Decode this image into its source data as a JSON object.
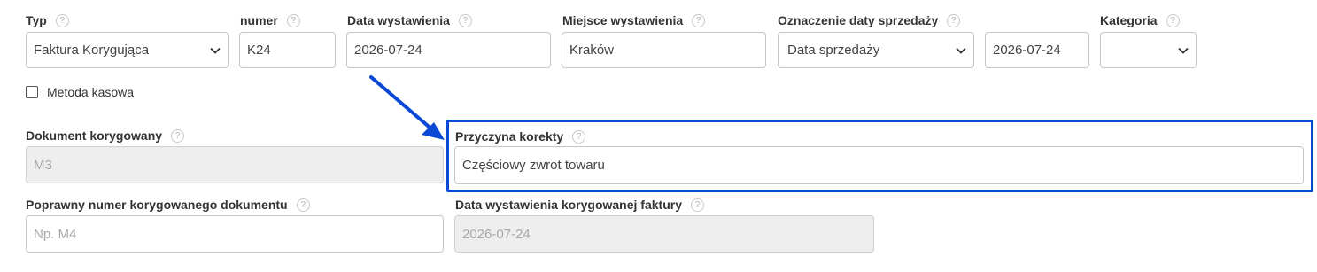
{
  "form": {
    "typ": {
      "label": "Typ",
      "value": "Faktura Korygująca"
    },
    "numer": {
      "label": "numer",
      "value": "K24"
    },
    "data_wystawienia": {
      "label": "Data wystawienia",
      "value": "2026-07-24"
    },
    "miejsce_wystawienia": {
      "label": "Miejsce wystawienia",
      "value": "Kraków"
    },
    "oznaczenie_daty_sprzedazy": {
      "label": "Oznaczenie daty sprzedaży",
      "value": "Data sprzedaży",
      "date_value": "2026-07-24"
    },
    "kategoria": {
      "label": "Kategoria",
      "value": ""
    },
    "metoda_kasowa": {
      "label": "Metoda kasowa",
      "checked": false
    },
    "dokument_korygowany": {
      "label": "Dokument korygowany",
      "value": "M3"
    },
    "przyczyna_korekty": {
      "label": "Przyczyna korekty",
      "value": "Częściowy zwrot towaru"
    },
    "poprawny_numer": {
      "label": "Poprawny numer korygowanego dokumentu",
      "placeholder": "Np. M4"
    },
    "data_wystawienia_korygowanej": {
      "label": "Data wystawienia korygowanej faktury",
      "value": "2026-07-24"
    }
  },
  "help_glyph": "?",
  "annotation": {
    "color": "#0a49d6",
    "icon": "arrow-down-right-icon"
  }
}
